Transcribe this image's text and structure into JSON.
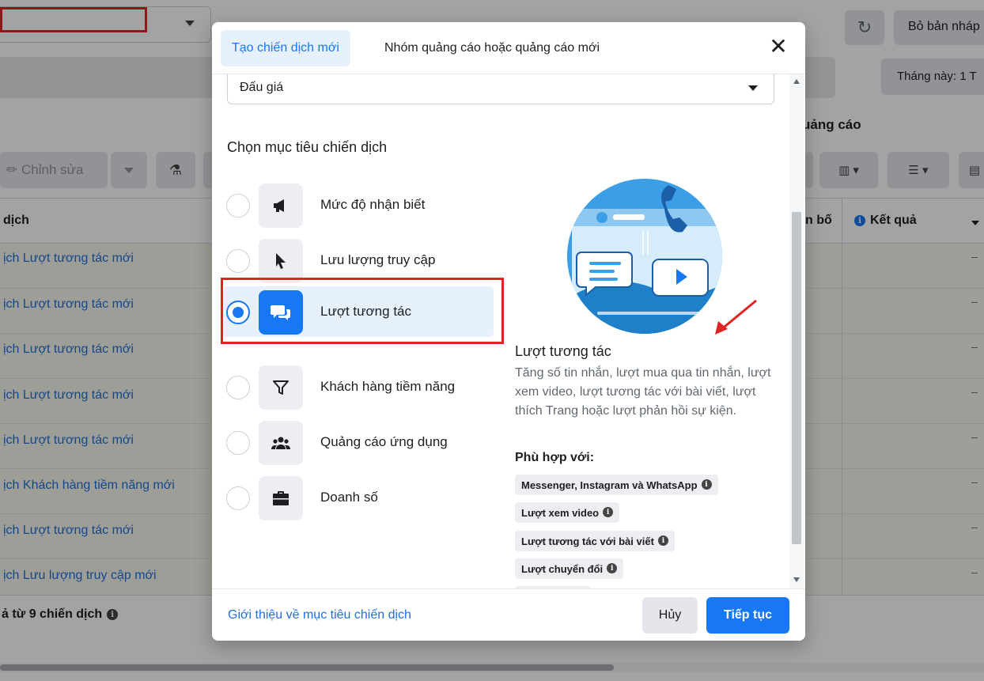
{
  "background": {
    "discard_label": "Bỏ bản nháp",
    "date_range_label": "Tháng này: 1 T",
    "ads_tab_label": "uảng cáo",
    "edit_label": "Chỉnh sửa",
    "table_header": {
      "name_col": "dịch",
      "budget_col": "n bố",
      "result_col": "Kết quả"
    },
    "rows": [
      "ịch Lượt tương tác mới",
      "ịch Lượt tương tác mới",
      "ịch Lượt tương tác mới",
      "ịch Lượt tương tác mới",
      "ịch Lượt tương tác mới",
      "ịch Khách hàng tiềm năng mới",
      "ịch Lượt tương tác mới",
      "ịch Lưu lượng truy cập mới"
    ],
    "row_result_placeholder": "–",
    "footer_total": "ả từ 9 chiến dịch"
  },
  "modal": {
    "tabs": [
      {
        "label": "Tạo chiến dịch mới",
        "active": true
      },
      {
        "label": "Nhóm quảng cáo hoặc quảng cáo mới",
        "active": false
      }
    ],
    "close_glyph": "✕",
    "bid_strategy_value": "Đấu giá",
    "section_title": "Chọn mục tiêu chiến dịch",
    "objectives": [
      {
        "label": "Mức độ nhận biết",
        "icon": "megaphone-icon",
        "selected": false
      },
      {
        "label": "Lưu lượng truy cập",
        "icon": "cursor-icon",
        "selected": false
      },
      {
        "label": "Lượt tương tác",
        "icon": "chat-bubbles-icon",
        "selected": true
      },
      {
        "label": "Khách hàng tiềm năng",
        "icon": "funnel-icon",
        "selected": false
      },
      {
        "label": "Quảng cáo ứng dụng",
        "icon": "people-icon",
        "selected": false
      },
      {
        "label": "Doanh số",
        "icon": "briefcase-icon",
        "selected": false
      }
    ],
    "detail": {
      "title": "Lượt tương tác",
      "description": "Tăng số tin nhắn, lượt mua qua tin nhắn, lượt xem video, lượt tương tác với bài viết, lượt thích Trang hoặc lượt phản hồi sự kiện.",
      "fit_title": "Phù hợp với:",
      "chips": [
        "Messenger, Instagram và WhatsApp",
        "Lượt xem video",
        "Lượt tương tác với bài viết",
        "Lượt chuyển đổi"
      ]
    },
    "footer": {
      "learn_link": "Giới thiệu về mục tiêu chiến dịch",
      "cancel_label": "Hủy",
      "continue_label": "Tiếp tục"
    }
  },
  "colors": {
    "accent": "#1877f2",
    "annotation_red": "#e02424"
  }
}
